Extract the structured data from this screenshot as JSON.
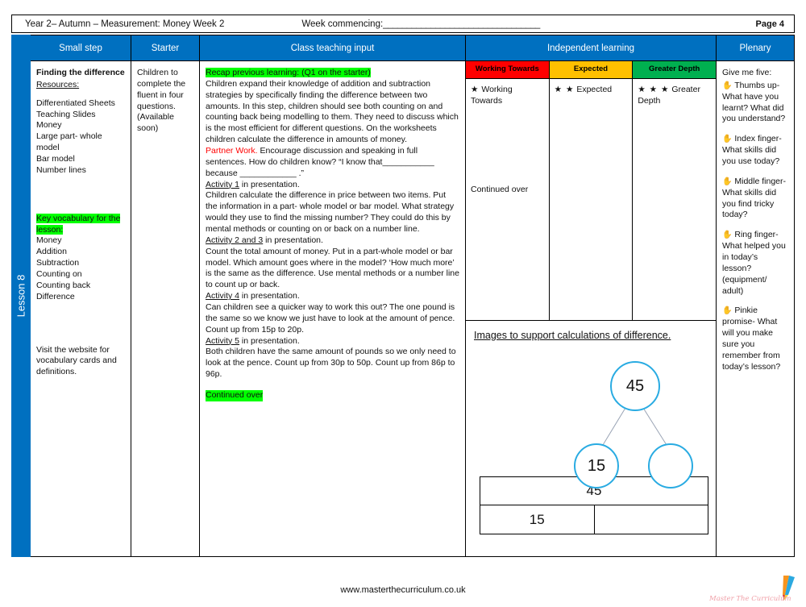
{
  "header": {
    "title": "Year 2– Autumn – Measurement: Money Week 2",
    "week_commencing_label": "Week commencing:",
    "week_commencing_rule": "_________________________________",
    "page_label": "Page 4"
  },
  "spine": {
    "lesson_label": "Lesson 8"
  },
  "columns": {
    "small_step": "Small step",
    "starter": "Starter",
    "teaching": "Class teaching input",
    "independent": "Independent learning",
    "plenary": "Plenary"
  },
  "small_step": {
    "title": "Finding the difference",
    "resources_label": "Resources:",
    "resources": [
      "Differentiated Sheets",
      "Teaching Slides",
      "Money",
      "Large part- whole model",
      "Bar model",
      "Number lines"
    ],
    "vocab_heading": "Key vocabulary for the lesson:",
    "vocab": [
      "Money",
      "Addition",
      "Subtraction",
      "Counting on",
      "Counting back",
      "Difference"
    ],
    "note": "Visit the website for vocabulary cards and definitions."
  },
  "starter": {
    "text": "Children to complete the fluent in four questions. (Available soon)"
  },
  "teaching": {
    "recap_heading": "Recap previous learning: (Q1 on the starter)",
    "intro": "Children expand their knowledge of addition and subtraction strategies by specifically finding the difference between two amounts. In this step, children should see both counting on and counting back being modelling to them. They need to discuss which is the most efficient for different questions. On the worksheets children calculate the difference in amounts of money.",
    "partner_work_label": "Partner Work.",
    "partner_work_text": "Encourage discussion and speaking in full sentences. How do children know?  “I know that___________ because ____________ .”",
    "activity_1_label": "Activity 1",
    "activity_1_suffix": " in presentation.",
    "activity_1_text": "Children calculate the difference in price between two items. Put the information in  a part- whole model or bar model. What strategy would they use to find the missing number? They could do this by mental methods or counting on or back on a number line.",
    "activity_23_label": "Activity 2 and 3",
    "activity_23_suffix": " in presentation.",
    "activity_23_text": "Count the total amount of money. Put in a part-whole model or bar model. Which amount goes where in the model? ‘How much more’ is the same as the difference. Use mental methods or a number line to count up or back.",
    "activity_4_label": "Activity 4",
    "activity_4_suffix": " in presentation.",
    "activity_4_text": "Can children see a quicker way to work this out? The one pound is the same so we know we just have to look at the amount of pence. Count up  from 15p to 20p.",
    "activity_5_label": "Activity 5",
    "activity_5_suffix": " in presentation.",
    "activity_5_text": "Both children have the same amount of pounds so we only need to look at the pence. Count up from 30p to 50p. Count up from 86p to 96p.",
    "continued": "Continued over"
  },
  "independent": {
    "levels": [
      {
        "header": "Working Towards",
        "color": "#FF0000",
        "stars": "★",
        "label": "Working Towards"
      },
      {
        "header": "Expected",
        "color": "#FFC000",
        "stars": "★ ★",
        "label": "Expected"
      },
      {
        "header": "Greater Depth",
        "color": "#00B050",
        "stars": "★ ★ ★",
        "label": "Greater Depth"
      }
    ],
    "continued": "Continued over",
    "images_title": "Images to support calculations of difference.",
    "part_whole": {
      "whole": "45",
      "part_a": "15",
      "part_b": ""
    },
    "bar_model": {
      "whole": "45",
      "part_a": "15",
      "part_b": ""
    }
  },
  "plenary": {
    "title": "Give me five:",
    "items": [
      {
        "icon": "hand-icon",
        "text": "Thumbs up- What have you learnt? What did you understand?"
      },
      {
        "icon": "hand-icon",
        "text": "Index finger- What skills did you use today?"
      },
      {
        "icon": "hand-icon",
        "text": "Middle finger- What skills did you find tricky today?"
      },
      {
        "icon": "hand-icon",
        "text": "Ring finger- What helped you in today’s lesson? (equipment/ adult)"
      },
      {
        "icon": "hand-icon",
        "text": "Pinkie promise- What will you make sure you remember from today’s lesson?"
      }
    ]
  },
  "footer": {
    "url": "www.masterthecurriculum.co.uk",
    "logo_text": "Master  The  Curriculum"
  }
}
